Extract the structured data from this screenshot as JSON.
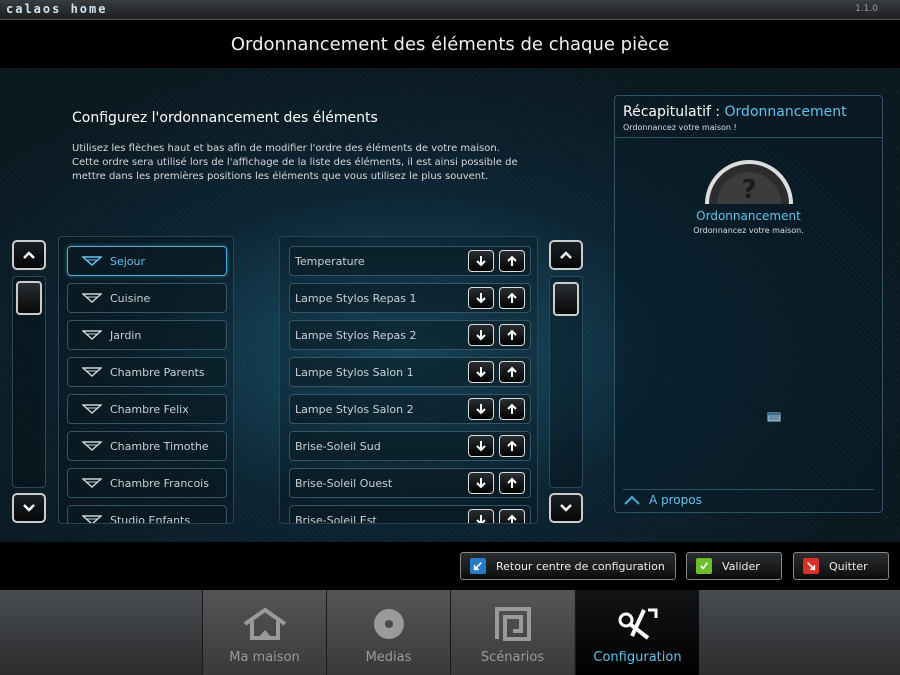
{
  "app": {
    "logo": "calaos home",
    "version": "1.1.0"
  },
  "page_title": "Ordonnancement des éléments de chaque pièce",
  "config": {
    "title": "Configurez l'ordonnancement des éléments",
    "description": "Utilisez les flèches haut et bas afin de modifier l'ordre des éléments de votre maison. Cette ordre sera utilisé lors de l'affichage de la liste des éléments, il est ainsi possible de mettre dans les premières positions les éléments que vous utilisez le plus souvent."
  },
  "rooms": [
    {
      "label": "Sejour",
      "selected": true
    },
    {
      "label": "Cuisine"
    },
    {
      "label": "Jardin"
    },
    {
      "label": "Chambre Parents"
    },
    {
      "label": "Chambre Felix"
    },
    {
      "label": "Chambre Timothe"
    },
    {
      "label": "Chambre Francois"
    },
    {
      "label": "Studio Enfants"
    }
  ],
  "elements": [
    {
      "label": "Temperature"
    },
    {
      "label": "Lampe Stylos Repas 1"
    },
    {
      "label": "Lampe Stylos Repas 2"
    },
    {
      "label": "Lampe Stylos Salon 1"
    },
    {
      "label": "Lampe Stylos Salon 2"
    },
    {
      "label": "Brise-Soleil Sud"
    },
    {
      "label": "Brise-Soleil Ouest"
    },
    {
      "label": "Brise-Soleil Est"
    }
  ],
  "recap": {
    "title_prefix": "Récapitulatif : ",
    "title_accent": "Ordonnancement",
    "subtitle": "Ordonnancez votre maison !",
    "gauge_symbol": "?",
    "item_label": "Ordonnancement",
    "item_sub": "Ordonnancez votre maison.",
    "about": "A propos"
  },
  "actions": {
    "back": "Retour centre de configuration",
    "validate": "Valider",
    "quit": "Quitter"
  },
  "nav": [
    {
      "label": "Ma maison"
    },
    {
      "label": "Medias"
    },
    {
      "label": "Scénarios"
    },
    {
      "label": "Configuration",
      "active": true
    }
  ],
  "colors": {
    "accent": "#5fc3ef",
    "validate": "#6abf2a",
    "quit": "#d8302a",
    "back": "#2a78c8"
  }
}
